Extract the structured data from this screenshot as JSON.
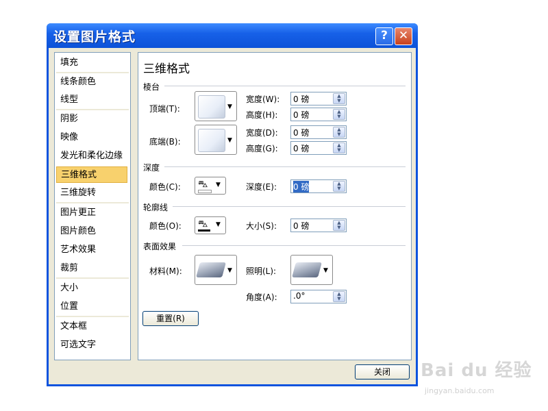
{
  "window": {
    "title": "设置图片格式",
    "help_glyph": "?",
    "close_glyph": "✕"
  },
  "nav": [
    {
      "label": "填充"
    },
    {
      "label": "线条颜色"
    },
    {
      "label": "线型"
    },
    {
      "label": "阴影"
    },
    {
      "label": "映像"
    },
    {
      "label": "发光和柔化边缘"
    },
    {
      "label": "三维格式",
      "selected": true
    },
    {
      "label": "三维旋转"
    },
    {
      "label": "图片更正"
    },
    {
      "label": "图片颜色"
    },
    {
      "label": "艺术效果"
    },
    {
      "label": "裁剪"
    },
    {
      "label": "大小"
    },
    {
      "label": "位置"
    },
    {
      "label": "文本框"
    },
    {
      "label": "可选文字"
    }
  ],
  "panel": {
    "title": "三维格式",
    "bevel": {
      "section": "棱台",
      "top_label": "顶端(T):",
      "bottom_label": "底端(B):",
      "top_width_label": "宽度(W):",
      "top_width_value": "0 磅",
      "top_height_label": "高度(H):",
      "top_height_value": "0 磅",
      "bottom_width_label": "宽度(D):",
      "bottom_width_value": "0 磅",
      "bottom_height_label": "高度(G):",
      "bottom_height_value": "0 磅"
    },
    "depth": {
      "section": "深度",
      "color_label": "颜色(C):",
      "depth_label": "深度(E):",
      "depth_value": "0 磅"
    },
    "contour": {
      "section": "轮廓线",
      "color_label": "颜色(O):",
      "size_label": "大小(S):",
      "size_value": "0 磅"
    },
    "surface": {
      "section": "表面效果",
      "material_label": "材料(M):",
      "lighting_label": "照明(L):",
      "angle_label": "角度(A):",
      "angle_value": ".0°"
    },
    "reset_label": "重置(R)"
  },
  "footer": {
    "close_label": "关闭"
  },
  "watermark": {
    "brand": "Bai du 经验",
    "url": "jingyan.baidu.com"
  },
  "colors": {
    "title_bar": "#0c52d8",
    "selection": "#f8d16d",
    "dialog_bg": "#ece9d8"
  }
}
